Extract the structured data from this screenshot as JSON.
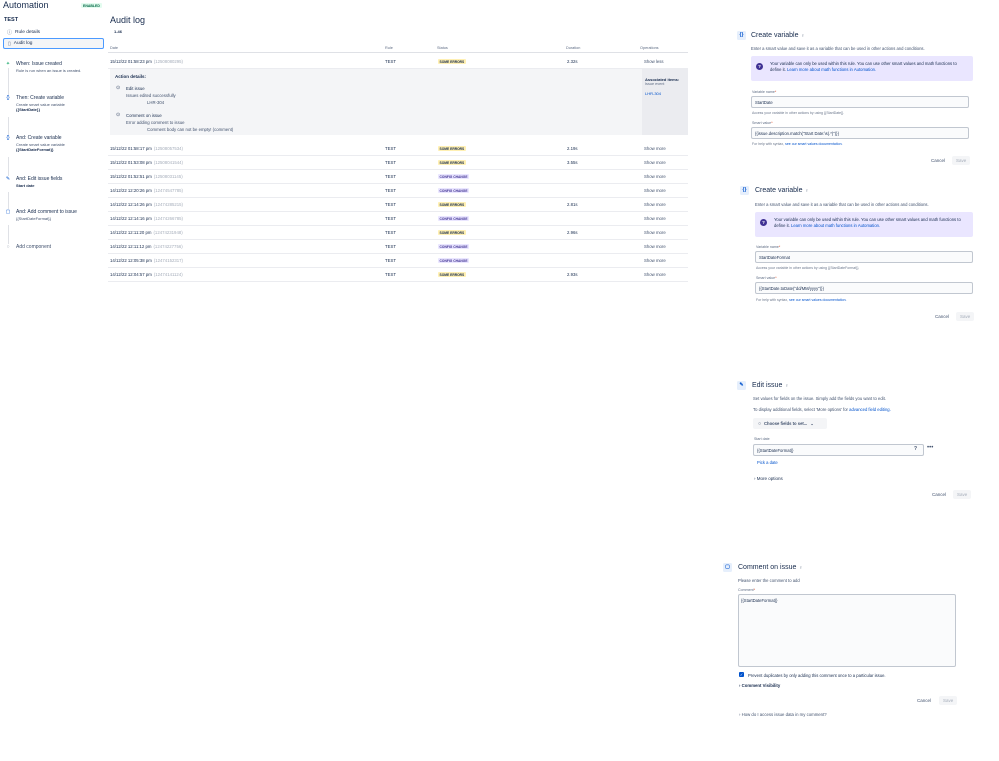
{
  "app": {
    "title": "Automation",
    "enabled_badge": "ENABLED",
    "rule_name": "TEST"
  },
  "sidebar": {
    "nav": [
      {
        "label": "Rule details",
        "icon": "info-icon"
      },
      {
        "label": "Audit log",
        "icon": "clipboard-icon"
      }
    ],
    "components": [
      {
        "title": "When: Issue created",
        "desc": "Rule is run when an issue is created.",
        "value": "",
        "icon": "bolt-icon"
      },
      {
        "title": "Then: Create variable",
        "desc": "Create smart value variable",
        "value": "{{StartDate}}",
        "icon": "braces-icon"
      },
      {
        "title": "And: Create variable",
        "desc": "Create smart value variable",
        "value": "{{StartDateFormat}}",
        "icon": "braces-icon"
      },
      {
        "title": "And: Edit issue fields",
        "desc": "",
        "value": "Start date",
        "icon": "pencil-icon"
      },
      {
        "title": "And: Add comment to issue",
        "desc": "{{StartDateFormat}}",
        "value": "",
        "icon": "comment-icon"
      }
    ],
    "add_component": "Add component"
  },
  "audit": {
    "title": "Audit log",
    "range": "1-46",
    "columns": {
      "date": "Date",
      "rule": "Rule",
      "status": "Status",
      "duration": "Duration",
      "operations": "Operations"
    },
    "details": {
      "header": "Action details:",
      "actions": [
        {
          "title": "Edit issue",
          "line1": "Issues edited successfully",
          "line2": "LHR-304"
        },
        {
          "title": "Comment on issue",
          "line1": "Error adding comment to issue",
          "line2": "Comment body can not be empty! (comment)"
        }
      ],
      "assoc_title": "Associated items:",
      "assoc_type": "Issue event",
      "assoc_key": "LHR-304"
    },
    "rows": [
      {
        "date": "15/12/22 01:58:23 pm",
        "id": "(12508080295)",
        "rule": "TEST",
        "status": "SOME ERRORS",
        "kind": "err",
        "duration": "2.32s",
        "op": "Show less"
      },
      {
        "date": "15/12/22 01:58:17 pm",
        "id": "(12508057534)",
        "rule": "TEST",
        "status": "SOME ERRORS",
        "kind": "err",
        "duration": "2.19s",
        "op": "Show more"
      },
      {
        "date": "15/12/22 01:53:08 pm",
        "id": "(12508041544)",
        "rule": "TEST",
        "status": "SOME ERRORS",
        "kind": "err",
        "duration": "3.55s",
        "op": "Show more"
      },
      {
        "date": "15/12/22 01:52:51 pm",
        "id": "(12508031145)",
        "rule": "TEST",
        "status": "CONFIG CHANGE",
        "kind": "cfg",
        "duration": "",
        "op": "Show more"
      },
      {
        "date": "14/12/22 12:20:26 pm",
        "id": "(12474547785)",
        "rule": "TEST",
        "status": "CONFIG CHANGE",
        "kind": "cfg",
        "duration": "",
        "op": "Show more"
      },
      {
        "date": "14/12/22 12:14:26 pm",
        "id": "(12474285215)",
        "rule": "TEST",
        "status": "SOME ERRORS",
        "kind": "err",
        "duration": "2.81s",
        "op": "Show more"
      },
      {
        "date": "14/12/22 12:14:16 pm",
        "id": "(12474266785)",
        "rule": "TEST",
        "status": "CONFIG CHANGE",
        "kind": "cfg",
        "duration": "",
        "op": "Show more"
      },
      {
        "date": "14/12/22 12:11:20 pm",
        "id": "(12474231948)",
        "rule": "TEST",
        "status": "SOME ERRORS",
        "kind": "err",
        "duration": "2.96s",
        "op": "Show more"
      },
      {
        "date": "14/12/22 12:11:12 pm",
        "id": "(12474227756)",
        "rule": "TEST",
        "status": "CONFIG CHANGE",
        "kind": "cfg",
        "duration": "",
        "op": "Show more"
      },
      {
        "date": "14/12/22 12:05:38 pm",
        "id": "(12474152317)",
        "rule": "TEST",
        "status": "CONFIG CHANGE",
        "kind": "cfg",
        "duration": "",
        "op": "Show more"
      },
      {
        "date": "14/12/22 12:04:57 pm",
        "id": "(12474141124)",
        "rule": "TEST",
        "status": "SOME ERRORS",
        "kind": "err",
        "duration": "2.93s",
        "op": "Show more"
      }
    ]
  },
  "panel_var1": {
    "title": "Create variable",
    "desc": "Enter a smart value and save it as a variable that can be used in other actions and conditions.",
    "info": "Your variable can only be used within this rule. You can use other smart values and math functions to define it.",
    "info_link": "Learn more about math functions in Automation.",
    "name_label": "Variable name",
    "name_value": "StartDate",
    "name_help": "Access your variable in other actions by using {{StartDate}}",
    "smart_label": "Smart value",
    "smart_value": "{{issue.description.match(\"Start Date:\\s(.*)\")}}",
    "help_prefix": "For help with syntax,",
    "help_link": "see our smart values documentation.",
    "cancel": "Cancel",
    "save": "Save"
  },
  "panel_var2": {
    "title": "Create variable",
    "desc": "Enter a smart value and save it as a variable that can be used in other actions and conditions.",
    "info": "Your variable can only be used within this rule. You can use other smart values and math functions to define it.",
    "info_link": "Learn more about math functions in Automation.",
    "name_label": "Variable name",
    "name_value": "StartDateFormat",
    "name_help": "Access your variable in other actions by using {{StartDateFormat}}",
    "smart_label": "Smart value",
    "smart_value": "{{StartDate.toDate(\"dd/MM/yyyy\")}}",
    "help_prefix": "For help with syntax,",
    "help_link": "see our smart values documentation.",
    "cancel": "Cancel",
    "save": "Save"
  },
  "panel_edit": {
    "title": "Edit issue",
    "desc1": "Set values for fields on the issue. Simply add the fields you want to edit.",
    "desc2": "To display additional fields, select 'More options' for",
    "desc2_link": "advanced field editing.",
    "chooser": "Choose fields to set...",
    "field_label": "Start date",
    "field_value": "{{StartDateFormat}}",
    "pick": "Pick a date",
    "more_options": "More options",
    "cancel": "Cancel",
    "save": "Save"
  },
  "panel_comment": {
    "title": "Comment on issue",
    "desc": "Please enter the comment to add",
    "label": "Comment",
    "value": "{{StartDateFormat}}",
    "prevent": "Prevent duplicates by only adding this comment once to a particular issue.",
    "visibility": "Comment Visibility",
    "cancel": "Cancel",
    "save": "Save",
    "help": "How do I access issue data in my comment?"
  }
}
